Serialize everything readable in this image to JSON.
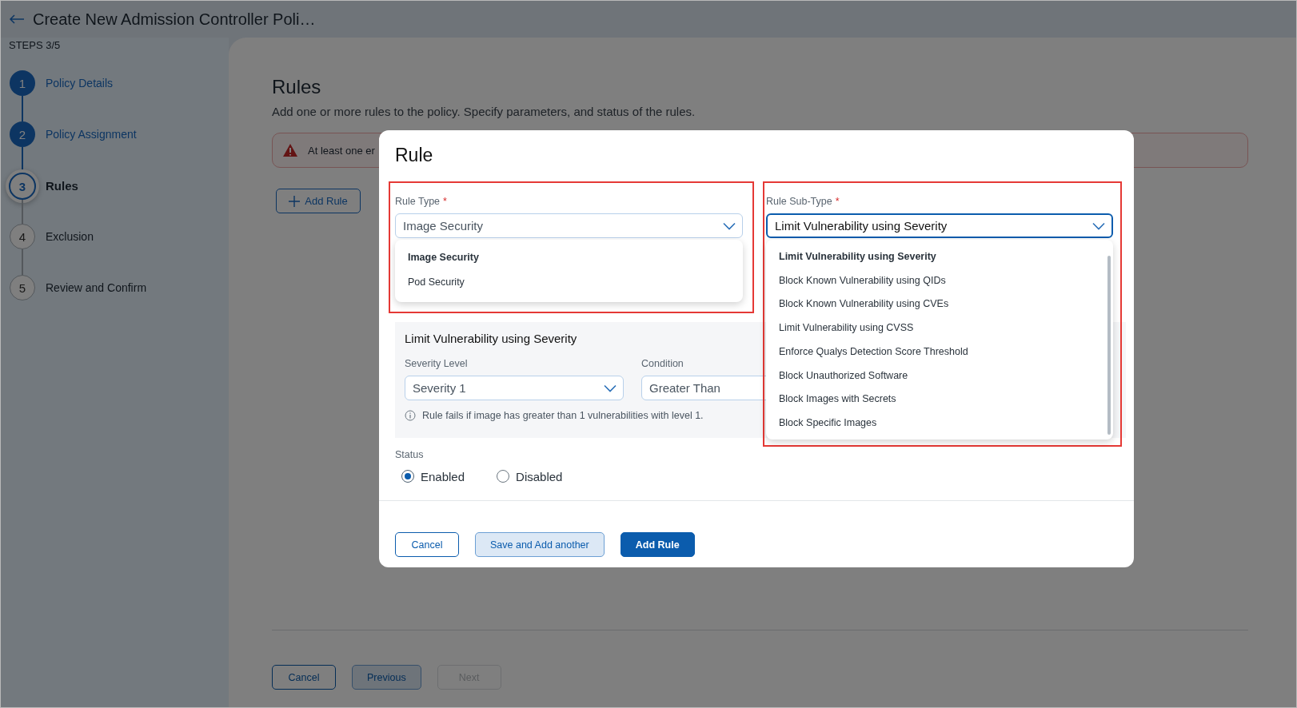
{
  "header": {
    "title": "Create New Admission Controller Poli…",
    "steps_counter": "STEPS 3/5"
  },
  "steps": [
    {
      "number": "1",
      "label": "Policy Details",
      "done": true,
      "selected": false
    },
    {
      "number": "2",
      "label": "Policy Assignment",
      "done": true,
      "selected": false
    },
    {
      "number": "3",
      "label": "Rules",
      "done": false,
      "selected": true
    },
    {
      "number": "4",
      "label": "Exclusion",
      "done": false,
      "selected": false
    },
    {
      "number": "5",
      "label": "Review and Confirm",
      "done": false,
      "selected": false
    }
  ],
  "main": {
    "heading": "Rules",
    "description": "Add one or more rules to the policy. Specify parameters, and status of the rules.",
    "alert": "At least one er",
    "add_rule": "Add Rule",
    "buttons": [
      {
        "label": "Cancel",
        "kind": "outline",
        "disabled": false
      },
      {
        "label": "Previous",
        "kind": "secondary",
        "disabled": false
      },
      {
        "label": "Next",
        "kind": "outline",
        "disabled": true
      }
    ]
  },
  "modal": {
    "title": "Rule",
    "rule_type": {
      "label": "Rule Type",
      "required_mark": "*",
      "value": "Image Security",
      "focused": false,
      "options": [
        {
          "label": "Image Security",
          "selected": true
        },
        {
          "label": "Pod Security",
          "selected": false
        }
      ]
    },
    "rule_sub_type": {
      "label": "Rule Sub-Type",
      "required_mark": "*",
      "value": "Limit Vulnerability using Severity",
      "focused": true,
      "options": [
        {
          "label": "Limit Vulnerability using Severity",
          "selected": true
        },
        {
          "label": "Block Known Vulnerability using QIDs",
          "selected": false
        },
        {
          "label": "Block Known Vulnerability using CVEs",
          "selected": false
        },
        {
          "label": "Limit Vulnerability using CVSS",
          "selected": false
        },
        {
          "label": "Enforce Qualys Detection Score Threshold",
          "selected": false
        },
        {
          "label": "Block Unauthorized Software",
          "selected": false
        },
        {
          "label": "Block Images with Secrets",
          "selected": false
        },
        {
          "label": "Block Specific Images",
          "selected": false
        }
      ]
    },
    "details": {
      "title": "Limit Vulnerability using Severity",
      "severity_level": {
        "label": "Severity Level",
        "value": "Severity 1"
      },
      "condition": {
        "label": "Condition",
        "value": "Greater Than"
      },
      "info": "Rule fails if image has greater than 1 vulnerabilities with level 1."
    },
    "status": {
      "label": "Status",
      "options": [
        {
          "label": "Enabled",
          "selected": true
        },
        {
          "label": "Disabled",
          "selected": false
        }
      ]
    },
    "buttons": [
      {
        "label": "Cancel",
        "kind": "outline",
        "disabled": false
      },
      {
        "label": "Save and Add another",
        "kind": "secondary",
        "disabled": false
      },
      {
        "label": "Add Rule",
        "kind": "primary",
        "disabled": false
      }
    ]
  }
}
